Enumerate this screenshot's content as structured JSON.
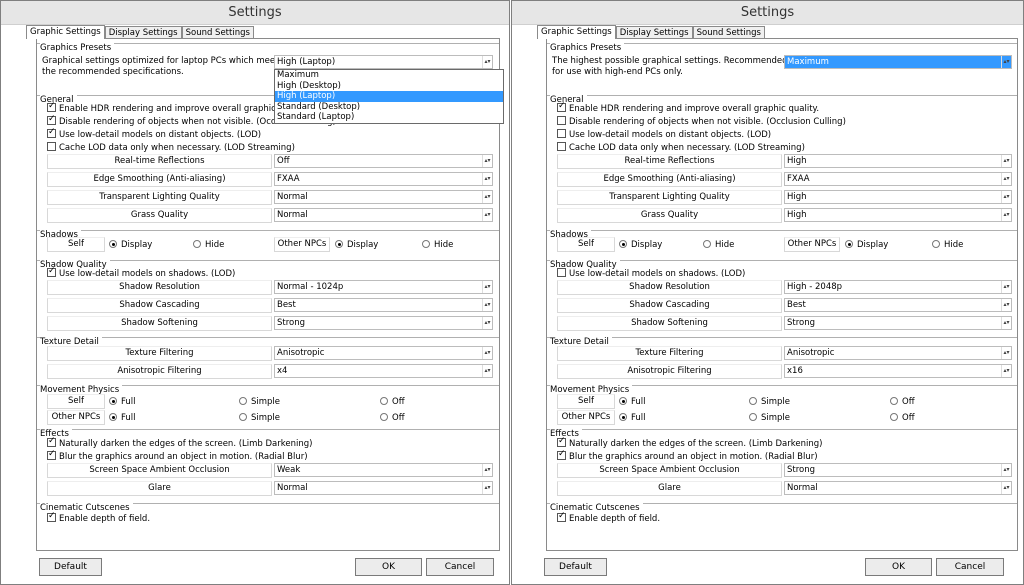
{
  "left": {
    "title": "Settings",
    "tabs": [
      "Graphic Settings",
      "Display Settings",
      "Sound Settings"
    ],
    "presets": {
      "title": "Graphics Presets",
      "desc1": "Graphical settings optimized for laptop PCs which meet",
      "desc2": "the recommended specifications.",
      "value": "High (Laptop)",
      "options": [
        "Maximum",
        "High (Desktop)",
        "High (Laptop)",
        "Standard (Desktop)",
        "Standard (Laptop)"
      ]
    },
    "general": {
      "title": "General",
      "hdr": "Enable HDR rendering and improve overall graphic qua",
      "occ": "Disable rendering of objects when not visible. (Occlusion Culling)",
      "lod": "Use low-detail models on distant objects. (LOD)",
      "lodstream": "Cache LOD data only when necessary. (LOD Streaming)",
      "refl_label": "Real-time Reflections",
      "refl_value": "Off",
      "edge_label": "Edge Smoothing (Anti-aliasing)",
      "edge_value": "FXAA",
      "trans_label": "Transparent Lighting Quality",
      "trans_value": "Normal",
      "grass_label": "Grass Quality",
      "grass_value": "Normal"
    },
    "shadows": {
      "title": "Shadows",
      "self": "Self",
      "display": "Display",
      "hide": "Hide",
      "other": "Other NPCs"
    },
    "shadow_quality": {
      "title": "Shadow Quality",
      "lod": "Use low-detail models on shadows. (LOD)",
      "res_label": "Shadow Resolution",
      "res_value": "Normal - 1024p",
      "casc_label": "Shadow Cascading",
      "casc_value": "Best",
      "soft_label": "Shadow Softening",
      "soft_value": "Strong"
    },
    "texture": {
      "title": "Texture Detail",
      "filt_label": "Texture Filtering",
      "filt_value": "Anisotropic",
      "aniso_label": "Anisotropic Filtering",
      "aniso_value": "x4"
    },
    "movement": {
      "title": "Movement Physics",
      "self": "Self",
      "other": "Other NPCs",
      "full": "Full",
      "simple": "Simple",
      "off": "Off"
    },
    "effects": {
      "title": "Effects",
      "limb": "Naturally darken the edges of the screen. (Limb Darkening)",
      "blur": "Blur the graphics around an object in motion. (Radial Blur)",
      "ssao_label": "Screen Space Ambient Occlusion",
      "ssao_value": "Weak",
      "glare_label": "Glare",
      "glare_value": "Normal"
    },
    "cinematic": {
      "title": "Cinematic Cutscenes",
      "dof": "Enable depth of field."
    },
    "buttons": {
      "default": "Default",
      "ok": "OK",
      "cancel": "Cancel"
    }
  },
  "right": {
    "title": "Settings",
    "tabs": [
      "Graphic Settings",
      "Display Settings",
      "Sound Settings"
    ],
    "presets": {
      "title": "Graphics Presets",
      "desc1": "The highest possible graphical settings. Recommended",
      "desc2": "for use with high-end PCs only.",
      "value": "Maximum"
    },
    "general": {
      "title": "General",
      "hdr": "Enable HDR rendering and improve overall graphic quality.",
      "occ": "Disable rendering of objects when not visible. (Occlusion Culling)",
      "lod": "Use low-detail models on distant objects. (LOD)",
      "lodstream": "Cache LOD data only when necessary. (LOD Streaming)",
      "refl_label": "Real-time Reflections",
      "refl_value": "High",
      "edge_label": "Edge Smoothing (Anti-aliasing)",
      "edge_value": "FXAA",
      "trans_label": "Transparent Lighting Quality",
      "trans_value": "High",
      "grass_label": "Grass Quality",
      "grass_value": "High"
    },
    "shadows": {
      "title": "Shadows",
      "self": "Self",
      "display": "Display",
      "hide": "Hide",
      "other": "Other NPCs"
    },
    "shadow_quality": {
      "title": "Shadow Quality",
      "lod": "Use low-detail models on shadows. (LOD)",
      "res_label": "Shadow Resolution",
      "res_value": "High - 2048p",
      "casc_label": "Shadow Cascading",
      "casc_value": "Best",
      "soft_label": "Shadow Softening",
      "soft_value": "Strong"
    },
    "texture": {
      "title": "Texture Detail",
      "filt_label": "Texture Filtering",
      "filt_value": "Anisotropic",
      "aniso_label": "Anisotropic Filtering",
      "aniso_value": "x16"
    },
    "movement": {
      "title": "Movement Physics",
      "self": "Self",
      "other": "Other NPCs",
      "full": "Full",
      "simple": "Simple",
      "off": "Off"
    },
    "effects": {
      "title": "Effects",
      "limb": "Naturally darken the edges of the screen. (Limb Darkening)",
      "blur": "Blur the graphics around an object in motion. (Radial Blur)",
      "ssao_label": "Screen Space Ambient Occlusion",
      "ssao_value": "Strong",
      "glare_label": "Glare",
      "glare_value": "Normal"
    },
    "cinematic": {
      "title": "Cinematic Cutscenes",
      "dof": "Enable depth of field."
    },
    "buttons": {
      "default": "Default",
      "ok": "OK",
      "cancel": "Cancel"
    }
  }
}
